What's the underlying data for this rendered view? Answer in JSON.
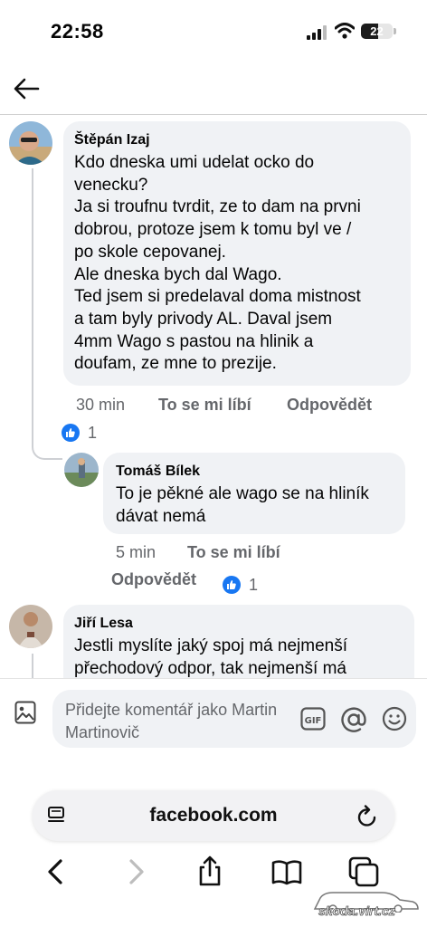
{
  "status_bar": {
    "time": "22:58",
    "battery": "22"
  },
  "comments": [
    {
      "author": "Štěpán Izaj",
      "text": "Kdo dneska umi udelat ocko do\nvenecku?\nJa si troufnu tvrdit, ze to dam na prvni\ndobrou, protoze jsem k tomu byl ve /\npo skole cepovanej.\nAle dneska bych dal Wago.\nTed jsem si predelaval doma mistnost\na tam byly privody AL. Daval jsem\n4mm Wago s pastou na hlinik a\ndoufam, ze mne to prezije.",
      "time": "30 min",
      "like_label": "To se mi líbí",
      "reply_label": "Odpovědět",
      "reactions": "1"
    },
    {
      "author": "Tomáš Bílek",
      "text": "To je pěkné ale wago se na hliník\ndávat nemá",
      "time": "5 min",
      "like_label": "To se mi líbí",
      "reply_label": "Odpovědět",
      "reactions": "1"
    },
    {
      "author": "Jiří Lesa",
      "text": "Jestli myslíte jaký spoj má nejmenší\npřechodový odpor, tak nejmenší má"
    }
  ],
  "composer": {
    "placeholder": "Přidejte komentář jako Martin Martinovič"
  },
  "browser": {
    "url": "facebook.com"
  },
  "watermark": "skoda.virt.cz",
  "colors": {
    "accent": "#1877f2",
    "bubble": "#f0f2f5",
    "meta": "#65676b"
  },
  "icons": [
    "back-arrow-icon",
    "photo-icon",
    "gif-icon",
    "at-icon",
    "smile-icon",
    "tabs-icon",
    "reload-icon",
    "back-icon",
    "forward-icon",
    "share-icon",
    "bookmarks-icon",
    "tab-switcher-icon",
    "like-icon"
  ]
}
